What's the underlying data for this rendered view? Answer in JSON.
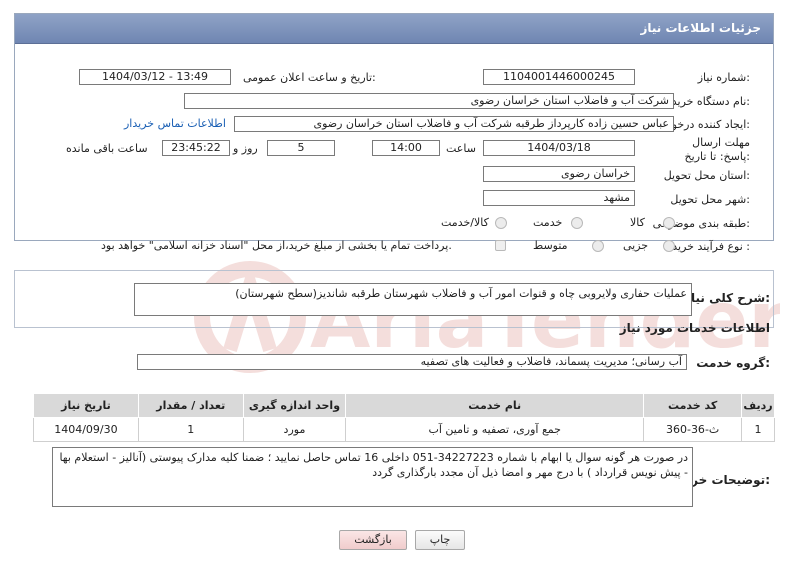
{
  "panel": {
    "title": "جزئیات اطلاعات نیاز"
  },
  "fields": {
    "need_number_label": "شماره نیاز:",
    "need_number": "1104001446000245",
    "announce_label": "تاریخ و ساعت اعلان عمومی:",
    "announce_value": "1404/03/12 - 13:49",
    "buyer_org_label": "نام دستگاه خریدار:",
    "buyer_org": "شرکت آب و فاضلاب استان خراسان رضوی",
    "creator_label": "ایجاد کننده درخواست:",
    "creator": "عباس حسین زاده کارپرداز طرقبه  شرکت آب و فاضلاب استان خراسان رضوی",
    "contact_link": "اطلاعات تماس خریدار",
    "deadline_label": "مهلت ارسال پاسخ: تا تاریخ:",
    "deadline_date": "1404/03/18",
    "time_label": "ساعت",
    "deadline_time": "14:00",
    "days_value": "5",
    "days_label": "روز و",
    "remaining_time": "23:45:22",
    "remaining_label": "ساعت باقی مانده",
    "province_label": "استان محل تحویل:",
    "province": "خراسان رضوی",
    "city_label": "شهر محل تحویل:",
    "city": "مشهد",
    "category_label": "طبقه بندی موضوعی:",
    "category_options": [
      "کالا",
      "خدمت",
      "کالا/خدمت"
    ],
    "process_label": "نوع فرآیند خرید :",
    "process_options": [
      "جزیی",
      "متوسط"
    ],
    "payment_note": "پرداخت تمام یا بخشی از مبلغ خرید،از محل \"اسناد خزانه اسلامی\" خواهد بود."
  },
  "summary": {
    "label": "شرح کلی نیاز:",
    "text": "عملیات حفاری ولایروبی چاه و  قنوات امور آب و فاضلاب شهرستان طرقبه شاندیز(سطح شهرستان)"
  },
  "services": {
    "heading": "اطلاعات خدمات مورد نیاز",
    "group_label": "گروه خدمت:",
    "group_value": "آب رسانی؛ مدیریت پسماند، فاضلاب و فعالیت های تصفیه",
    "columns": [
      "ردیف",
      "کد خدمت",
      "نام خدمت",
      "واحد اندازه گیری",
      "تعداد / مقدار",
      "تاریخ نیاز"
    ],
    "rows": [
      [
        "1",
        "ث-36-360",
        "جمع آوری، تصفیه و تامین آب",
        "مورد",
        "1",
        "1404/09/30"
      ]
    ]
  },
  "notes": {
    "label": "توضیحات خریدار:",
    "text": "در صورت هر گونه سوال یا ابهام با شماره 34227223-051 داخلی 16   تماس حاصل نمایید ؛ ضمنا کلیه مدارک پیوستی (آنالیز - استعلام بها - پیش نویس قرارداد ) با درج مهر و امضا ذیل آن مجدد بارگذاری گردد"
  },
  "buttons": {
    "print": "چاپ",
    "back": "بازگشت"
  },
  "watermark_text": "AriaTender.neT",
  "colors": {
    "header": "#7d92bb",
    "link": "#1a5fb4",
    "back_button_bg": "#f4d9d9"
  }
}
